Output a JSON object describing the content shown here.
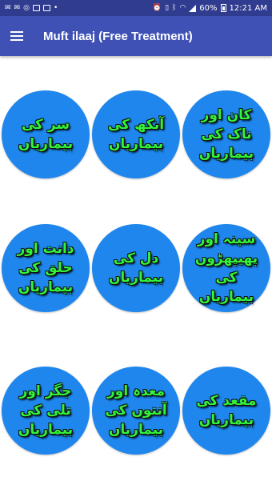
{
  "status_bar": {
    "battery": "60%",
    "time": "12:21 AM"
  },
  "app_bar": {
    "title": "Muft ilaaj (Free Treatment)"
  },
  "categories": [
    {
      "label": "سر کی بیماریاں"
    },
    {
      "label": "آنکھ کی بیماریاں"
    },
    {
      "label": "کان اور ناک کی بیماریاں"
    },
    {
      "label": "دانت اور حلق کی بیماریاں"
    },
    {
      "label": "دل کی بیماریاں"
    },
    {
      "label": "سینہ اور پھیپھڑوں کی بیماریاں"
    },
    {
      "label": "جگر اور تلی کی بیماریاں"
    },
    {
      "label": "معدہ اور آنتوں کی بیماریاں"
    },
    {
      "label": "مقعد کی بیماریاں"
    }
  ]
}
